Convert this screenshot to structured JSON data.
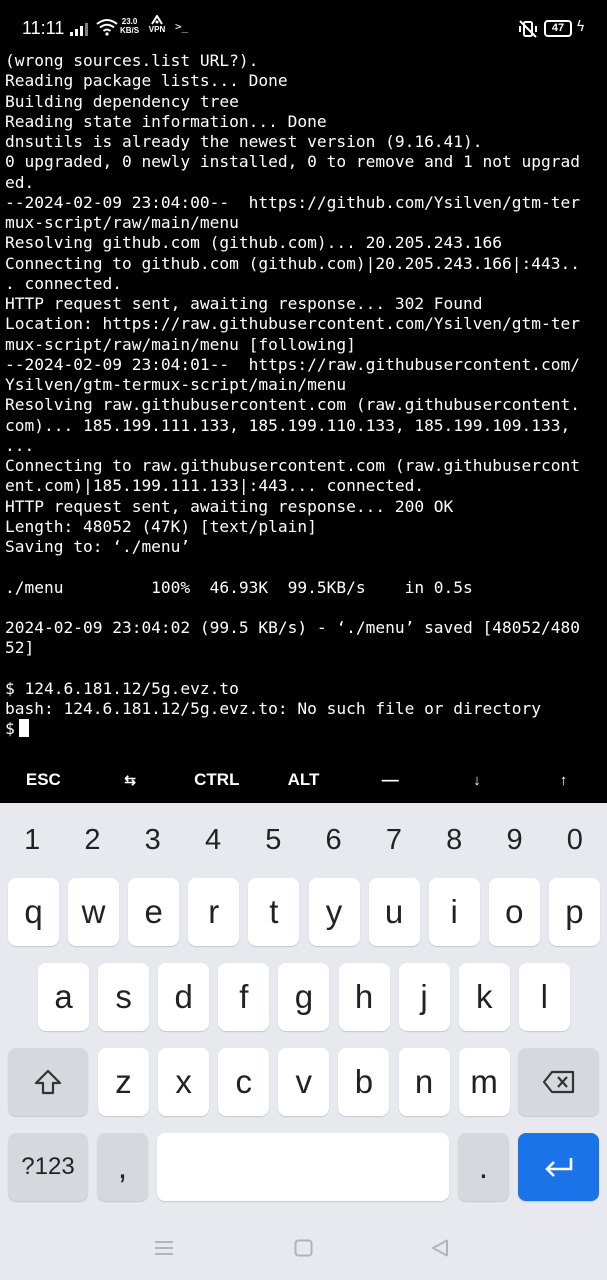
{
  "status_bar": {
    "time": "11:11",
    "speed_value": "23.0",
    "speed_unit": "KB/S",
    "vpn_label": "VPN",
    "terminal_glyph": ">_",
    "battery": "47"
  },
  "terminal": {
    "lines": [
      "(wrong sources.list URL?).",
      "Reading package lists... Done",
      "Building dependency tree",
      "Reading state information... Done",
      "dnsutils is already the newest version (9.16.41).",
      "0 upgraded, 0 newly installed, 0 to remove and 1 not upgrad",
      "ed.",
      "--2024-02-09 23:04:00--  https://github.com/Ysilven/gtm-ter",
      "mux-script/raw/main/menu",
      "Resolving github.com (github.com)... 20.205.243.166",
      "Connecting to github.com (github.com)|20.205.243.166|:443..",
      ". connected.",
      "HTTP request sent, awaiting response... 302 Found",
      "Location: https://raw.githubusercontent.com/Ysilven/gtm-ter",
      "mux-script/raw/main/menu [following]",
      "--2024-02-09 23:04:01--  https://raw.githubusercontent.com/",
      "Ysilven/gtm-termux-script/main/menu",
      "Resolving raw.githubusercontent.com (raw.githubusercontent.",
      "com)... 185.199.111.133, 185.199.110.133, 185.199.109.133,",
      "...",
      "Connecting to raw.githubusercontent.com (raw.githubusercont",
      "ent.com)|185.199.111.133|:443... connected.",
      "HTTP request sent, awaiting response... 200 OK",
      "Length: 48052 (47K) [text/plain]",
      "Saving to: ‘./menu’",
      "",
      "./menu         100%  46.93K  99.5KB/s    in 0.5s",
      "",
      "2024-02-09 23:04:02 (99.5 KB/s) - ‘./menu’ saved [48052/480",
      "52]",
      "",
      "$ 124.6.181.12/5g.evz.to",
      "bash: 124.6.181.12/5g.evz.to: No such file or directory"
    ],
    "prompt": "$"
  },
  "extra_keys": {
    "esc": "ESC",
    "tab": "⇆",
    "ctrl": "CTRL",
    "alt": "ALT",
    "dash": "—",
    "down": "↓",
    "up": "↑"
  },
  "keyboard": {
    "numbers": [
      "1",
      "2",
      "3",
      "4",
      "5",
      "6",
      "7",
      "8",
      "9",
      "0"
    ],
    "row1": [
      "q",
      "w",
      "e",
      "r",
      "t",
      "y",
      "u",
      "i",
      "o",
      "p"
    ],
    "row2": [
      "a",
      "s",
      "d",
      "f",
      "g",
      "h",
      "j",
      "k",
      "l"
    ],
    "row3": [
      "z",
      "x",
      "c",
      "v",
      "b",
      "n",
      "m"
    ],
    "symbols_label": "?123",
    "comma": ",",
    "period": "."
  },
  "colors": {
    "terminal_bg": "#000000",
    "terminal_fg": "#ffffff",
    "keyboard_bg": "#e8e9ee",
    "key_bg": "#ffffff",
    "special_key_bg": "#d6d8de",
    "enter_bg": "#1a73e8"
  }
}
